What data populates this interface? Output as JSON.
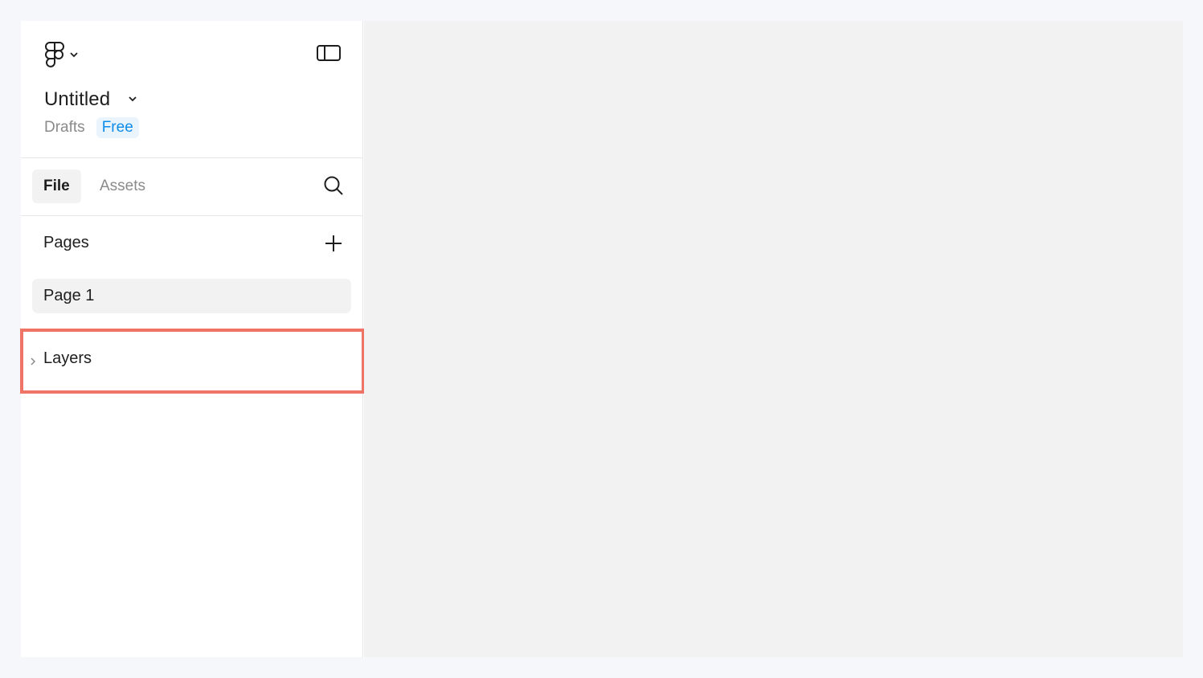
{
  "header": {
    "logo_icon": "figma-logo-icon",
    "logo_menu_icon": "chevron-down-icon",
    "panel_toggle_icon": "sidebar-toggle-icon",
    "file_title": "Untitled",
    "file_title_menu_icon": "chevron-down-icon",
    "location": "Drafts",
    "plan_badge": "Free"
  },
  "tabs": [
    {
      "label": "File",
      "active": true
    },
    {
      "label": "Assets",
      "active": false
    }
  ],
  "search_icon": "search-icon",
  "pages": {
    "title": "Pages",
    "add_icon": "plus-icon",
    "items": [
      {
        "label": "Page 1",
        "selected": true
      }
    ]
  },
  "layers": {
    "title": "Layers",
    "expand_icon": "chevron-right-icon",
    "highlighted": true
  },
  "colors": {
    "accent": "#0d8ce9",
    "highlight_border": "#f07466",
    "canvas_bg": "#f2f2f2",
    "text_primary": "#1e1e1e",
    "text_secondary": "#8a8a8a"
  }
}
